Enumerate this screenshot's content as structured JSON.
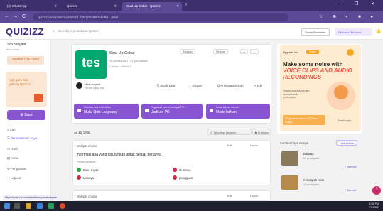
{
  "browser": {
    "tabs": [
      {
        "label": "(2) WhatsApp",
        "active": false
      },
      {
        "label": "Quizizz",
        "active": false
      },
      {
        "label": "Soal Up Cobai - Quizizz",
        "active": true
      }
    ],
    "new_tab": "+",
    "window_controls": "– ❐ ✕",
    "url": "quizizz.com/admin/quiz/62c4d...b0012/5c8f6db4e9b1...detail",
    "nav": {
      "back": "←",
      "forward": "→",
      "reload": "C"
    }
  },
  "header": {
    "logo": "QUIZIZZ",
    "search_placeholder": "Cari di perpustakaan Quizizz",
    "grade": "Grade Peralatan",
    "upgrade": "Perbarui Rencana"
  },
  "sidebar": {
    "user_name": "Desi Suryani",
    "user_sub": "akun Anda",
    "user_button": "Dapatkan Free Conten",
    "promo_text": "Ajak guru lain gabung Quizizz",
    "create_button": "Buat",
    "items": [
      {
        "label": "Cari",
        "active": false
      },
      {
        "label": "Perpustakaan saya",
        "active": true
      },
      {
        "label": "Hasil",
        "active": false
      },
      {
        "label": "Kelas",
        "active": false
      },
      {
        "label": "Pengaturan",
        "active": false
      },
      {
        "label": "Log out",
        "active": false
      }
    ]
  },
  "quiz": {
    "thumb_text": "tes",
    "title": "Soal Up Cobai",
    "meta_questions": "10 pertanyaan • 21 percobaan",
    "meta_grade": "Lainnya • Kelas 1",
    "author": "desi suryani",
    "author_date": "3 hari yang lalu",
    "toolbar": [
      "Bagikan",
      "Simpan",
      "★",
      "⋮"
    ],
    "actions": [
      "Bandingkan",
      "Simpan",
      "Print Bandingkan",
      "Edit"
    ],
    "big_buttons": [
      {
        "small": "Mainkan kuis ini di kelas",
        "label": "Mulai Quiz Langsung"
      },
      {
        "small": "Tugaskan kuis ini sebagai PR",
        "label": "Jadikan PR"
      },
      {
        "small": "Mode latihan mandiri",
        "label": "Mode latihan"
      }
    ]
  },
  "questions_section": {
    "count": "10 Soal",
    "sort": "Tampilkan jawaban",
    "preview": "Pratinjau",
    "q1": {
      "type": "Multiple choice",
      "text": "informasi apa yang dibutuhkan untuk belajar bertanya",
      "answer_label": "Pilihan jawaban",
      "options": [
        "Buku tugas",
        "Gurunya",
        "Lainnya",
        "gangguan"
      ]
    },
    "q2_type": "Multiple choice",
    "btn_edit": "Edit",
    "btn_delete": "Hapus"
  },
  "promo_panel": {
    "badge": "Upgrade ke",
    "super": "Super",
    "title1": "Make some noise with",
    "title2": "VOICE CLIPS AND AUDIO RECORDINGS",
    "desc": "Rekam suara Anda dan tambahkan ke pertanyaan",
    "cta": "Tingkatkan fitur di Quizizz Super",
    "later": "Nanti saja"
  },
  "similar": {
    "title": "Sumber daya serupa",
    "more": "Lihat semua",
    "items": [
      {
        "name": "Bahasa",
        "meta": "10 pertanyaan",
        "add": "+ Tambah"
      },
      {
        "name": "Kelompok Kata",
        "meta": "10 pertanyaan",
        "add": "+ Tambah"
      }
    ]
  },
  "status_url": "https://quizizz.com/admin/library/createdbyme",
  "taskbar": {
    "time": "2:58 PM",
    "date": "7/7/2022"
  },
  "colors": {
    "brand": "#8854d0",
    "chrome": "#5c4a96",
    "thumb": "#00a870",
    "promo_red": "#f0574a"
  }
}
